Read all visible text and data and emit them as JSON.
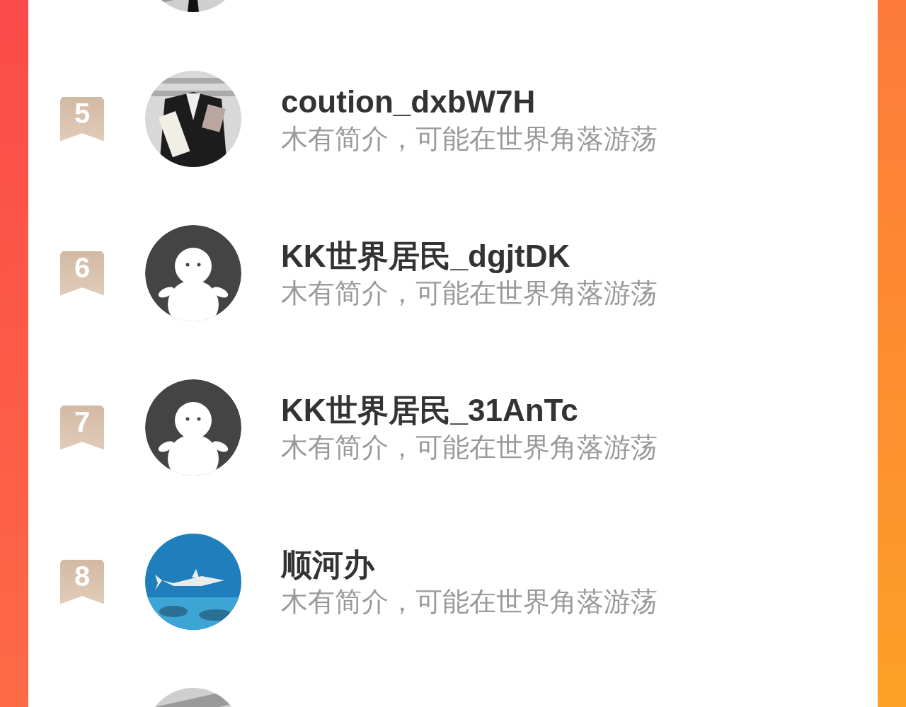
{
  "ranking": [
    {
      "avatar": {
        "kind": "picture"
      }
    },
    {
      "rank": "5",
      "name": "coution_dxbW7H",
      "bio": "木有简介，可能在世界角落游荡",
      "avatar": {
        "kind": "picture"
      }
    },
    {
      "rank": "6",
      "name": "KK世界居民_dgjtDK",
      "bio": "木有简介，可能在世界角落游荡",
      "avatar": {
        "kind": "default"
      }
    },
    {
      "rank": "7",
      "name": "KK世界居民_31AnTc",
      "bio": "木有简介，可能在世界角落游荡",
      "avatar": {
        "kind": "default"
      }
    },
    {
      "rank": "8",
      "name": "顺河办",
      "bio": "木有简介，可能在世界角落游荡",
      "avatar": {
        "kind": "picture"
      }
    },
    {
      "avatar": {
        "kind": "picture"
      }
    }
  ]
}
